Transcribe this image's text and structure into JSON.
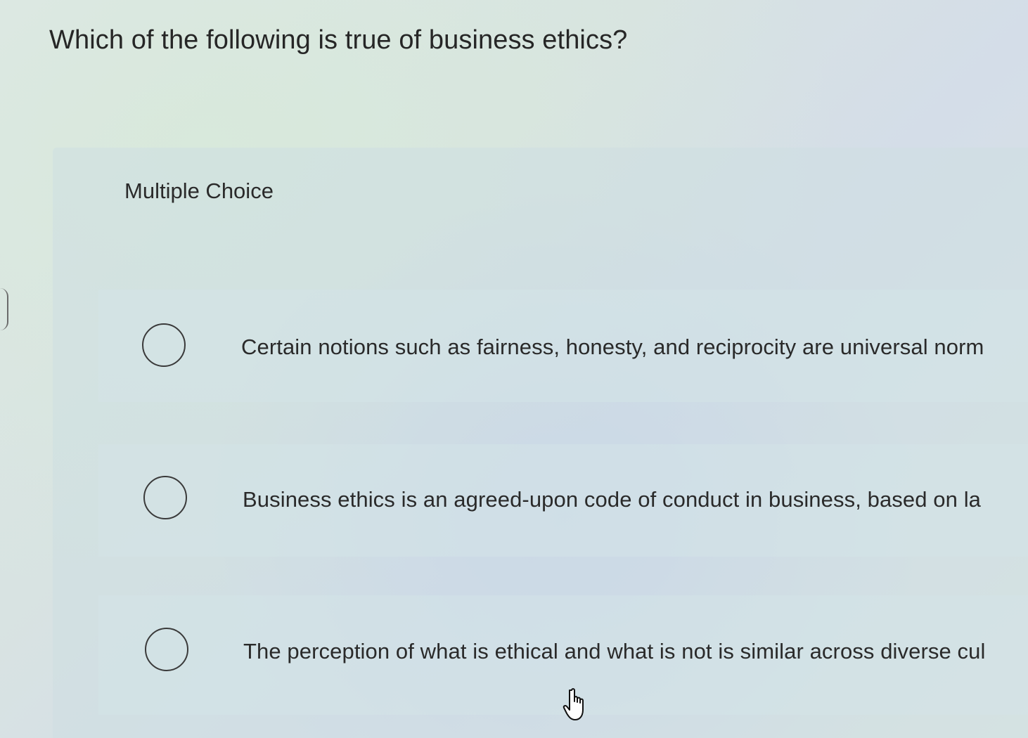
{
  "question": {
    "text": "Which of the following is true of business ethics?"
  },
  "quiz": {
    "type_label": "Multiple Choice",
    "options": [
      {
        "label": "Certain notions such as fairness, honesty, and reciprocity are universal norm"
      },
      {
        "label": "Business ethics is an agreed-upon code of conduct in business, based on la"
      },
      {
        "label": "The perception of what is ethical and what is not is similar across diverse cul"
      }
    ]
  },
  "icons": {
    "radio": "radio-circle-icon",
    "cursor": "hand-pointer-icon"
  },
  "colors": {
    "text": "#262626",
    "radio_border": "#3a3a3a"
  }
}
